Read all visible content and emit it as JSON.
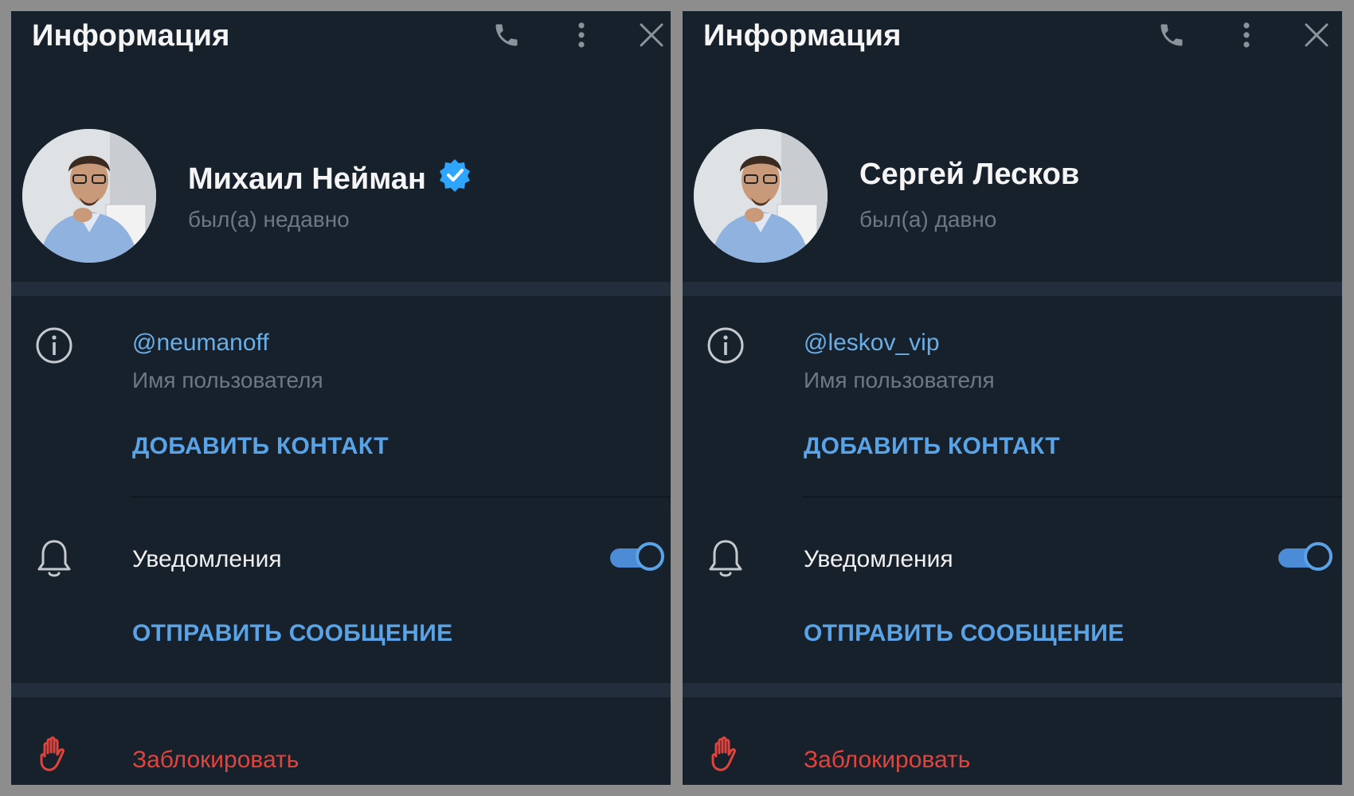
{
  "colors": {
    "panel_bg": "#17212b",
    "separator": "#232e3c",
    "accent_blue": "#5aa3e6",
    "username_blue": "#6aaee8",
    "muted_text": "#6d7883",
    "danger_red": "#e0443c",
    "verified_blue": "#2ea6ff"
  },
  "panels": [
    {
      "header": {
        "title": "Информация",
        "icons": [
          "phone-icon",
          "more-vertical-icon",
          "close-icon"
        ]
      },
      "profile": {
        "name": "Михаил Нейман",
        "verified": true,
        "status": "был(а) недавно"
      },
      "info": {
        "username": "@neumanoff",
        "username_label": "Имя пользователя",
        "add_contact": "ДОБАВИТЬ КОНТАКТ"
      },
      "notifications": {
        "label": "Уведомления",
        "enabled": true
      },
      "send_message": "ОТПРАВИТЬ СООБЩЕНИЕ",
      "block": "Заблокировать"
    },
    {
      "header": {
        "title": "Информация",
        "icons": [
          "phone-icon",
          "more-vertical-icon",
          "close-icon"
        ]
      },
      "profile": {
        "name": "Сергей Лесков",
        "verified": false,
        "status": "был(а) давно"
      },
      "info": {
        "username": "@leskov_vip",
        "username_label": "Имя пользователя",
        "add_contact": "ДОБАВИТЬ КОНТАКТ"
      },
      "notifications": {
        "label": "Уведомления",
        "enabled": true
      },
      "send_message": "ОТПРАВИТЬ СООБЩЕНИЕ",
      "block": "Заблокировать"
    }
  ]
}
